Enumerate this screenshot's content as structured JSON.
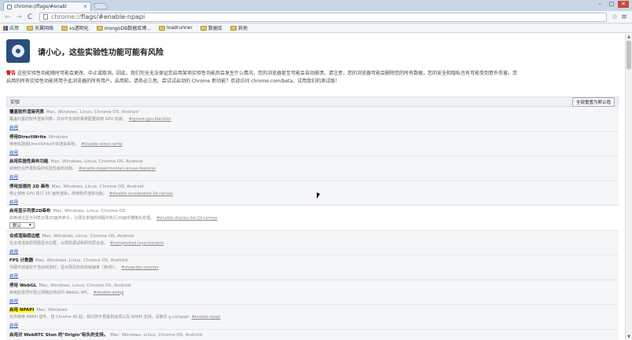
{
  "browser": {
    "tab_title": "chrome://flags/#enabl",
    "tab_close": "×",
    "window_controls": {
      "min": "–",
      "max": "□",
      "close": "✕"
    },
    "nav": {
      "back": "←",
      "forward": "→",
      "reload": "C"
    },
    "url_host": "chrome://",
    "url_path": "flags/#enable-npapi",
    "star": "☆",
    "menu": "≡"
  },
  "bookmarks": [
    {
      "label": "应用",
      "icon": "apps-icon"
    },
    {
      "label": "天翼网络",
      "icon": "folder-icon"
    },
    {
      "label": "vs透明化",
      "icon": "folder-icon"
    },
    {
      "label": "mongoDB数据库博...",
      "icon": "folder-icon"
    },
    {
      "label": "loadrunner",
      "icon": "folder-icon"
    },
    {
      "label": "数据库",
      "icon": "folder-icon"
    },
    {
      "label": "其他",
      "icon": "folder-icon"
    }
  ],
  "page": {
    "title": "请小心，这些实验性功能可能有风险",
    "warning_label": "警告",
    "warning_line1": "这些实验性功能随时可能会更改、中止或取消。因此，我们完全无法保证您启用某项实验性功能后会发生什么情况，您的浏览器甚至可能会自动崩溃。请注意，您的浏览器可能会删除您的所有数据，您的安全和隐私也有可能受到意外伤害。您",
    "warning_line2": "启用的所有实验性功能将用于此浏览器的所有用户。启用前，请务必三思。尝试试启动的 Chrome 新功能？欢迎访问 chrome.com/beta，试用我们的测试版！",
    "section_title": "实验",
    "reset_button": "全部重置为默认值"
  },
  "experiments": [
    {
      "name": "覆盖软件渲染列表",
      "platforms": "Mac, Windows, Linux, Chrome OS, Android",
      "desc": "覆盖内置的软件渲染列表，并对不支持的系统配置启用 GPU 加速。",
      "flag": "#ignore-gpu-blacklist",
      "action": "启用"
    },
    {
      "name": "停用DirectWrite",
      "platforms": "Windows",
      "desc": "停用实验版DirectWrite字体渲染系统。",
      "flag": "#disable-direct-write",
      "action": "启用"
    },
    {
      "name": "启用实验性画布功能",
      "platforms": "Mac, Windows, Linux, Chrome OS, Android",
      "desc": "启用仍在开发阶段的实验性画布功能。",
      "flag": "#enable-experimental-canvas-features",
      "action": "启用"
    },
    {
      "name": "停用加速的 2D 画布",
      "platforms": "Mac, Windows, Linux, Chrome OS, Android",
      "desc": "停止使用 GPU 执行 2D 画布渲染，改用软件渲染功能。",
      "flag": "#disable-accelerated-2d-canvas",
      "action": "启用"
    },
    {
      "name": "启用显示列表2D画布",
      "platforms": "Mac, Windows, Linux, Chrome OS",
      "desc": "启用通过显示列表记录2D画布命令，以便在单独的线程中执行2D画布栅格化处理。",
      "flag": "#enable-display-list-2d-canvas",
      "select_value": "默认",
      "select_arrow": "▾"
    },
    {
      "name": "合成渲染层边框",
      "platforms": "Mac, Windows, Linux, Chrome OS, Android",
      "desc": "在合成渲染层周围显示边框，以帮助调试和研究层合成。",
      "flag": "#composited-layer-borders",
      "action": "启用"
    },
    {
      "name": "FPS 计数器",
      "platforms": "Mac, Windows, Linux, Chrome OS, Android",
      "desc": "当硬件加速处于活动状态时，显示网页的实际帧速率（帧/秒）。",
      "flag": "#show-fps-counter",
      "action": "启用"
    },
    {
      "name": "停用 WebGL",
      "platforms": "Mac, Windows, Linux, Chrome OS, Android",
      "desc": "启用此选项可阻止网络应用访问 WebGL API。",
      "flag": "#disable-webgl",
      "action": "启用"
    },
    {
      "name": "启用 NPAPI",
      "platforms": "Mac, Windows",
      "desc": "允许使用 NPAPI 插件。自 Chrome 45 起，我们将不再提供此项以及 NPAPI 支持。请参见 g.co/npapi",
      "flag": "#enable-npapi",
      "action": "启用",
      "highlight": true
    },
    {
      "name": "启用对 WebRTC Stun 的\"Origin\"标头的支持。",
      "platforms": "Mac, Windows, Linux, Chrome OS, Android",
      "desc": "",
      "flag": "",
      "action": ""
    }
  ],
  "colors": {
    "warning": "#cc0000",
    "link": "#1a55c0",
    "highlight": "#ffff00"
  }
}
